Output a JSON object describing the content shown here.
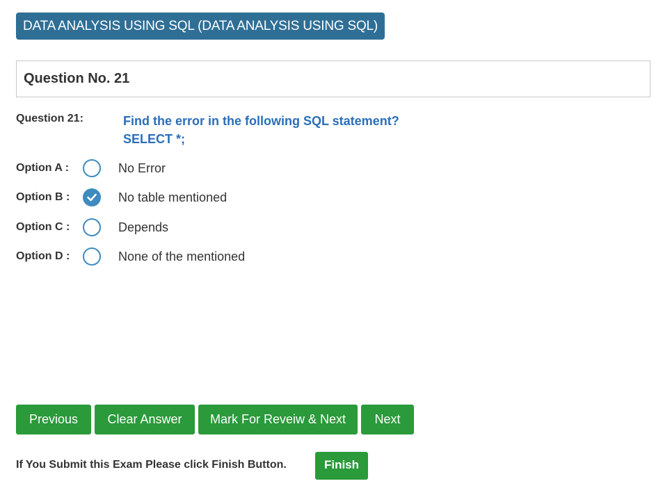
{
  "header": {
    "subject": "DATA ANALYSIS USING SQL (DATA ANALYSIS USING SQL)"
  },
  "question_box": {
    "title": "Question No. 21"
  },
  "question": {
    "label": "Question 21:",
    "text_line1": "Find the error in the following SQL statement?",
    "text_line2": "SELECT *;"
  },
  "options": [
    {
      "label": "Option A :",
      "text": "No Error",
      "selected": false
    },
    {
      "label": "Option B :",
      "text": "No table mentioned",
      "selected": true
    },
    {
      "label": "Option C :",
      "text": "Depends",
      "selected": false
    },
    {
      "label": "Option D :",
      "text": "None of the mentioned",
      "selected": false
    }
  ],
  "buttons": {
    "previous": "Previous",
    "clear": "Clear Answer",
    "mark_review": "Mark For Reveiw & Next",
    "next": "Next"
  },
  "footer": {
    "message": "If You Submit this Exam Please click Finish Button.",
    "finish": "Finish"
  },
  "colors": {
    "badge": "#2f6f96",
    "question_text": "#2a6ebb",
    "radio": "#3d8bbf",
    "button": "#2a9a3a"
  }
}
